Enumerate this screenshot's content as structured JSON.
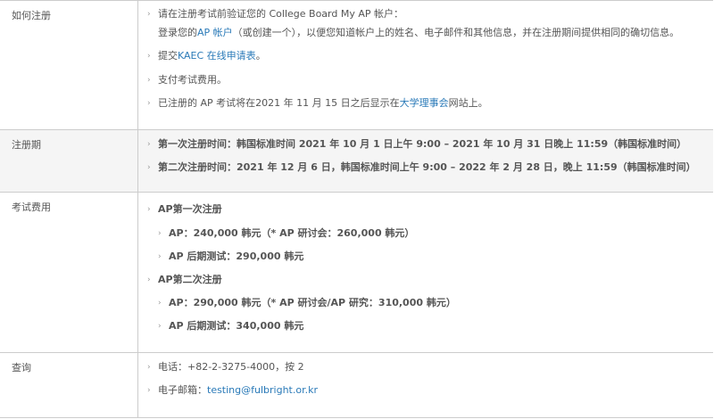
{
  "sections": [
    {
      "label": "如何注册",
      "items": [
        {
          "text": "请在注册考试前验证您的 College Board My AP 帐户：",
          "line2_pre": "登录您的",
          "line2_link": "AP 帐户",
          "line2_post": "（或创建一个），以便您知道帐户上的姓名、电子邮件和其他信息，并在注册期间提供相同的确切信息。"
        },
        {
          "pre": "提交",
          "link": "KAEC 在线申请表",
          "post": "。"
        },
        {
          "text": "支付考试费用。"
        },
        {
          "pre": "已注册的 AP 考试将在2021 年 11 月 15 日之后显示在",
          "link": "大学理事会",
          "post": "网站上。"
        }
      ]
    },
    {
      "label": "注册期",
      "items": [
        {
          "text": "第一次注册时间：韩国标准时间 2021 年 10 月 1 日上午 9:00 – 2021 年 10 月 31 日晚上 11:59（韩国标准时间）"
        },
        {
          "text": "第二次注册时间：2021 年 12 月 6 日，韩国标准时间上午 9:00 – 2022 年 2 月 28 日，晚上 11:59（韩国标准时间）"
        }
      ]
    },
    {
      "label": "考试费用",
      "groups": [
        {
          "title": "AP第一次注册",
          "items": [
            "AP：240,000 韩元（* AP 研讨会：260,000 韩元）",
            "AP 后期测试：290,000 韩元"
          ]
        },
        {
          "title": "AP第二次注册",
          "items": [
            "AP：290,000 韩元（* AP 研讨会/AP 研究：310,000 韩元）",
            "AP 后期测试：340,000 韩元"
          ]
        }
      ]
    },
    {
      "label": "查询",
      "items": [
        {
          "text": "电话：+82-2-3275-4000，按 2"
        },
        {
          "pre": "电子邮箱：",
          "link": "testing@fulbright.or.kr",
          "post": ""
        }
      ]
    }
  ],
  "icons": {
    "bullet": "chevron-right-icon",
    "glyph": "›"
  },
  "colors": {
    "link": "#2a7ab8",
    "border": "#cccccc",
    "shade": "#f5f5f5",
    "text": "#555555"
  }
}
